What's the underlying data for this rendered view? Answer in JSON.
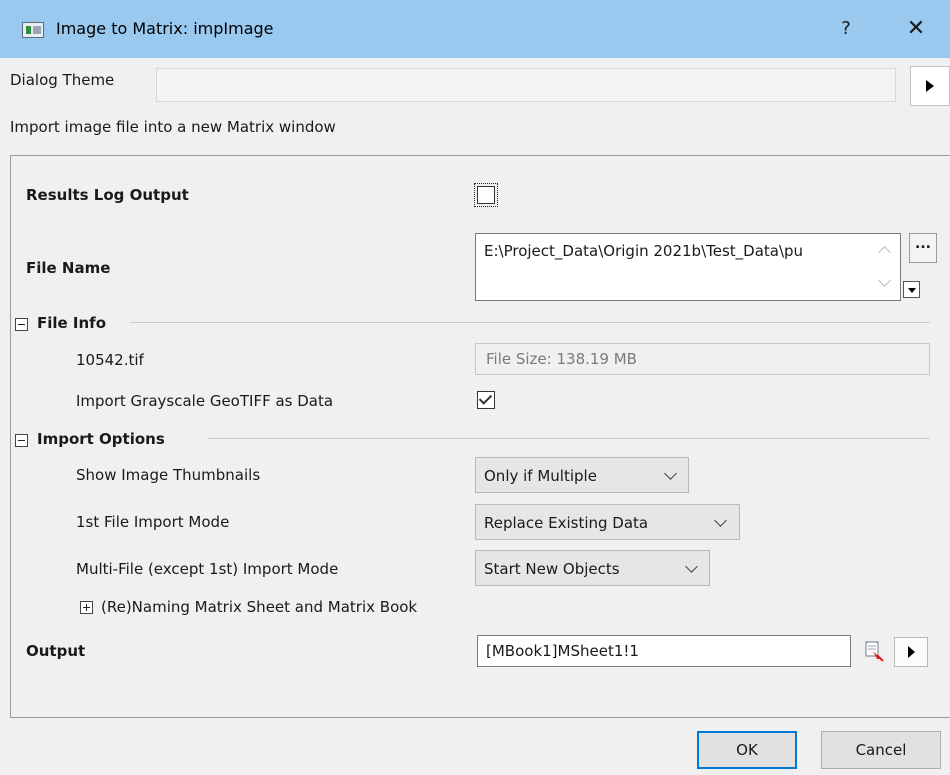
{
  "window": {
    "title": "Image to Matrix: impImage",
    "help_glyph": "?",
    "close_glyph": "✕",
    "icon": "matrix-window-icon"
  },
  "dialog_theme": {
    "label": "Dialog Theme",
    "value": ""
  },
  "description": "Import image file into a new Matrix window",
  "results_log": {
    "label": "Results Log Output",
    "checked": false
  },
  "file_name": {
    "label": "File Name",
    "value": "E:\\Project_Data\\Origin 2021b\\Test_Data\\pu",
    "browse_label": "..."
  },
  "file_info": {
    "section_label": "File Info",
    "file_label": "10542.tif",
    "file_size": "File Size: 138.19 MB",
    "geotiff_label": "Import Grayscale GeoTIFF as Data",
    "geotiff_checked": true
  },
  "import_options": {
    "section_label": "Import Options",
    "thumbnails_label": "Show Image Thumbnails",
    "thumbnails_value": "Only if Multiple",
    "first_mode_label": "1st File Import Mode",
    "first_mode_value": "Replace Existing Data",
    "multi_mode_label": "Multi-File (except 1st) Import Mode",
    "multi_mode_value": "Start New Objects",
    "renaming_label": "(Re)Naming Matrix Sheet and Matrix Book"
  },
  "output": {
    "label": "Output",
    "value": "[MBook1]MSheet1!1"
  },
  "buttons": {
    "ok": "OK",
    "cancel": "Cancel"
  },
  "colors": {
    "titlebar": "#99c9ef",
    "default_button_border": "#0078d7"
  }
}
